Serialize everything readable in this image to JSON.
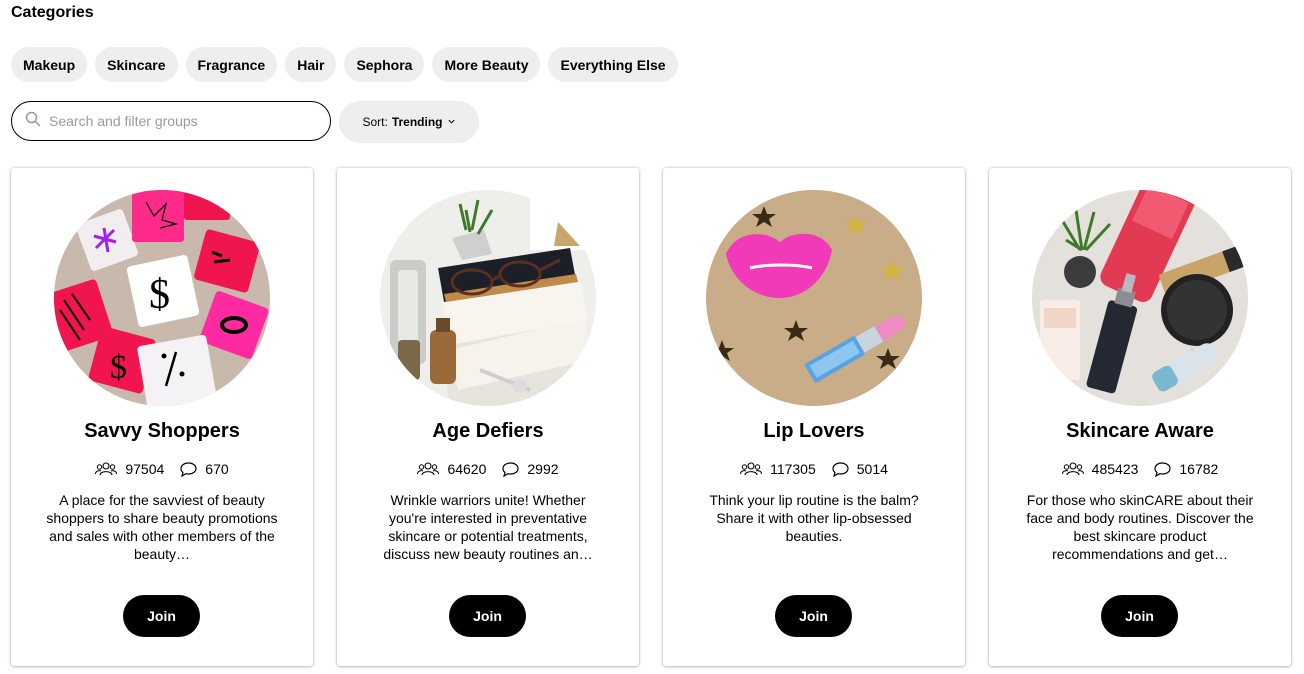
{
  "header": {
    "title": "Categories"
  },
  "categories": [
    "Makeup",
    "Skincare",
    "Fragrance",
    "Hair",
    "Sephora",
    "More Beauty",
    "Everything Else"
  ],
  "search": {
    "placeholder": "Search and filter groups",
    "icon": "search-icon"
  },
  "sort": {
    "label": "Sort:",
    "value": "Trending",
    "icon": "chevron-down-icon"
  },
  "groups": [
    {
      "name": "Savvy Shoppers",
      "members": "97504",
      "comments": "670",
      "description": "A place for the savviest of beauty shoppers to share beauty promotions and sales with other members of the beauty…",
      "join_label": "Join",
      "image": "price-tags-image"
    },
    {
      "name": "Age Defiers",
      "members": "64620",
      "comments": "2992",
      "description": "Wrinkle warriors unite! Whether you're interested in preventative skincare or potential treatments, discuss new beauty routines an…",
      "join_label": "Join",
      "image": "books-glasses-image"
    },
    {
      "name": "Lip Lovers",
      "members": "117305",
      "comments": "5014",
      "description": "Think your lip routine is the balm? Share it with other lip-obsessed beauties.",
      "join_label": "Join",
      "image": "lips-lipstick-image"
    },
    {
      "name": "Skincare Aware",
      "members": "485423",
      "comments": "16782",
      "description": "For those who skinCARE about their face and body routines. Discover the best skincare product recommendations and get…",
      "join_label": "Join",
      "image": "skincare-products-image"
    }
  ],
  "icons": {
    "members": "members-icon",
    "comments": "comment-icon"
  },
  "colors": {
    "chip_bg": "#eeeeee",
    "button_bg": "#000000",
    "button_text": "#ffffff"
  }
}
